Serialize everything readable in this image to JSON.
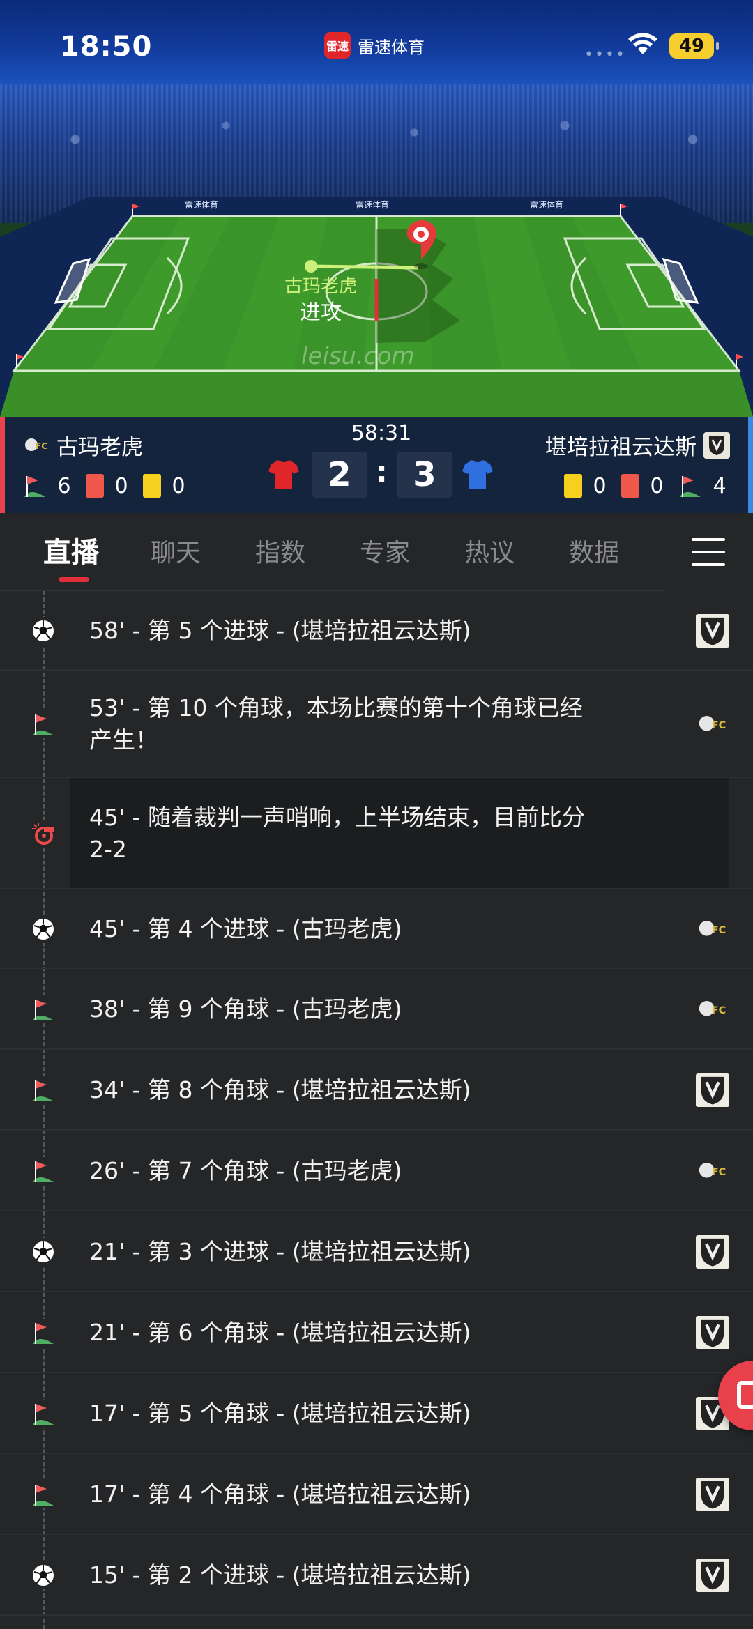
{
  "status_bar": {
    "time": "18:50",
    "app_logo_text": "雷速",
    "app_name": "雷速体育",
    "battery": "49"
  },
  "pitch": {
    "attack_team": "古玛老虎",
    "attack_action": "进攻",
    "watermark": "leisu.com",
    "board_text": "雷速体育"
  },
  "scoreboard": {
    "clock": "58:31",
    "home": {
      "name": "古玛老虎",
      "corners": "6",
      "red": "0",
      "yellow": "0",
      "score": "2",
      "shirt_color": "#e0252b"
    },
    "away": {
      "name": "堪培拉祖云达斯",
      "corners": "4",
      "red": "0",
      "yellow": "0",
      "score": "3",
      "shirt_color": "#2f6fe0"
    },
    "colon": ":"
  },
  "tabs": [
    {
      "label": "直播",
      "active": true
    },
    {
      "label": "聊天"
    },
    {
      "label": "指数"
    },
    {
      "label": "专家"
    },
    {
      "label": "热议"
    },
    {
      "label": "数据"
    }
  ],
  "events": [
    {
      "type": "goal",
      "line1": "58' - 第 5 个进球 - (堪培拉祖云达斯)",
      "team": "away"
    },
    {
      "type": "corner",
      "line1": "53' - 第 10 个角球，本场比赛的第十个角球已经",
      "line2": "产生！",
      "team": "home"
    },
    {
      "type": "whistle",
      "line1": "45' - 随着裁判一声哨响，上半场结束，目前比分",
      "line2": "2-2",
      "team": ""
    },
    {
      "type": "goal",
      "line1": "45' - 第 4 个进球 - (古玛老虎)",
      "team": "home"
    },
    {
      "type": "corner",
      "line1": "38' - 第 9 个角球 - (古玛老虎)",
      "team": "home"
    },
    {
      "type": "corner",
      "line1": "34' - 第 8 个角球 - (堪培拉祖云达斯)",
      "team": "away"
    },
    {
      "type": "corner",
      "line1": "26' - 第 7 个角球 - (古玛老虎)",
      "team": "home"
    },
    {
      "type": "goal",
      "line1": "21' - 第 3 个进球 - (堪培拉祖云达斯)",
      "team": "away"
    },
    {
      "type": "corner",
      "line1": "21' - 第 6 个角球 - (堪培拉祖云达斯)",
      "team": "away"
    },
    {
      "type": "corner",
      "line1": "17' - 第 5 个角球 - (堪培拉祖云达斯)",
      "team": "away"
    },
    {
      "type": "corner",
      "line1": "17' - 第 4 个角球 - (堪培拉祖云达斯)",
      "team": "away"
    },
    {
      "type": "goal",
      "line1": "15' - 第 2 个进球 - (堪培拉祖云达斯)",
      "team": "away"
    }
  ],
  "colors": {
    "accent_red": "#e0303a",
    "home_bar": "#e94250",
    "away_bar": "#3b87e8",
    "pitch_green": "#3f9a2c"
  }
}
